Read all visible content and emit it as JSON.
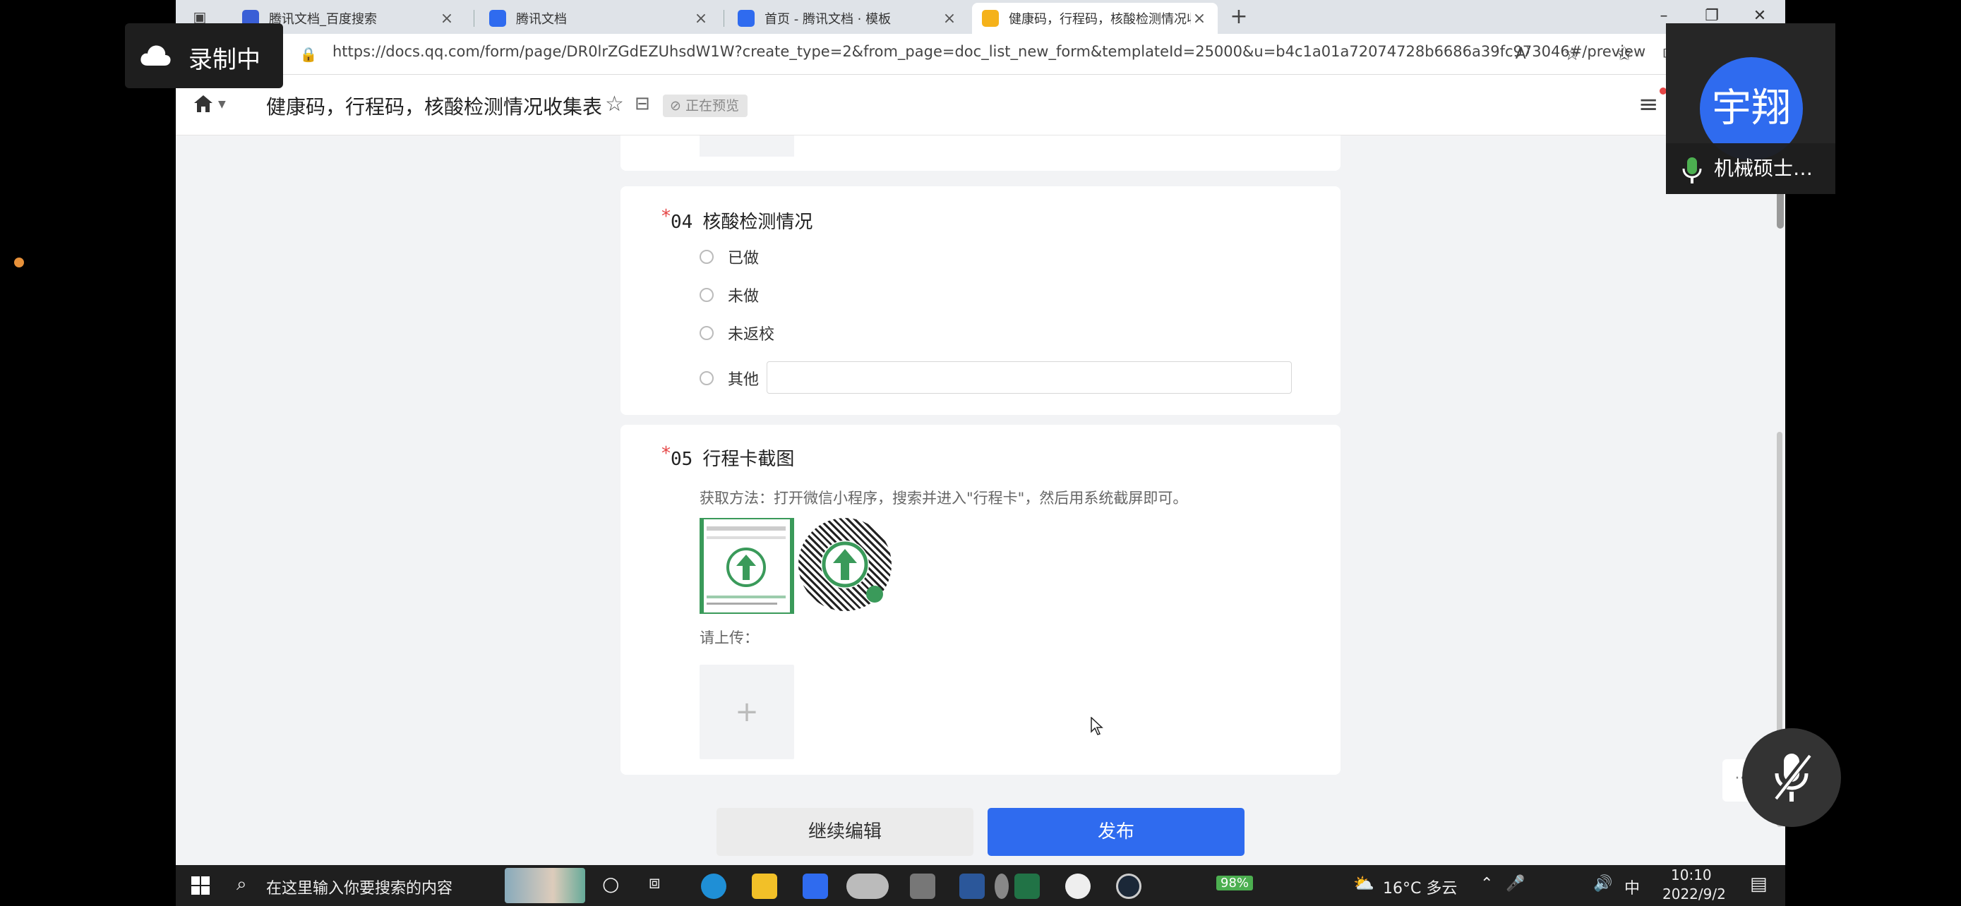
{
  "browser": {
    "tabs": [
      {
        "title": "腾讯文档_百度搜索",
        "active": false
      },
      {
        "title": "腾讯文档",
        "active": false
      },
      {
        "title": "首页 - 腾讯文档 · 模板",
        "active": false
      },
      {
        "title": "健康码，行程码，核酸检测情况收",
        "active": true
      }
    ],
    "url": "https://docs.qq.com/form/page/DR0lrZGdEZUhsdW1W?create_type=2&from_page=doc_list_new_form&templateId=25000&u=b4c1a01a72074728b6686a39fc973046#/preview"
  },
  "app_header": {
    "doc_title": "健康码，行程码，核酸检测情况收集表",
    "preview_badge": "正在预览"
  },
  "form": {
    "q4": {
      "required_mark": "*",
      "number": "04",
      "title": "核酸检测情况",
      "options": [
        "已做",
        "未做",
        "未返校",
        "其他"
      ]
    },
    "q5": {
      "required_mark": "*",
      "number": "05",
      "title": "行程卡截图",
      "hint": "获取方法：打开微信小程序，搜索并进入\"行程卡\"，然后用系统截屏即可。",
      "upload_label": "请上传：",
      "upload_plus": "+"
    },
    "buttons": {
      "continue_edit": "继续编辑",
      "publish": "发布"
    }
  },
  "overlays": {
    "recording_label": "录制中",
    "participant_avatar_text": "宇翔",
    "participant_name": "机械硕士…"
  },
  "taskbar": {
    "search_placeholder": "在这里输入你要搜索的内容",
    "battery": "98%",
    "weather": "16°C  多云",
    "ime": "中",
    "time": "10:10",
    "date": "2022/9/2"
  },
  "colors": {
    "primary": "#2f6bef",
    "required": "#e54545",
    "page_bg": "#f2f3f5",
    "qr_green": "#3a9a5a"
  }
}
